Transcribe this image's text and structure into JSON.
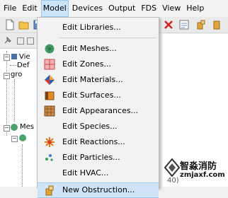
{
  "menubar": {
    "items": [
      "File",
      "Edit",
      "Model",
      "Devices",
      "Output",
      "FDS",
      "View",
      "Help"
    ]
  },
  "left_tree": {
    "labels": [
      "Vie",
      "Def",
      "gro",
      "Mes"
    ]
  },
  "right_panel": {
    "coords": "40)"
  },
  "model_menu": {
    "items": [
      {
        "label": "Edit Libraries...",
        "icon": "none"
      },
      {
        "label": "Edit Meshes...",
        "icon": "mesh-icon"
      },
      {
        "label": "Edit Zones...",
        "icon": "zone-icon"
      },
      {
        "label": "Edit Materials...",
        "icon": "material-icon"
      },
      {
        "label": "Edit Surfaces...",
        "icon": "surface-icon"
      },
      {
        "label": "Edit Appearances...",
        "icon": "appearance-icon"
      },
      {
        "label": "Edit Species...",
        "icon": "none"
      },
      {
        "label": "Edit Reactions...",
        "icon": "reaction-icon"
      },
      {
        "label": "Edit Particles...",
        "icon": "particle-icon"
      },
      {
        "label": "Edit HVAC...",
        "icon": "none"
      },
      {
        "label": "New Obstruction...",
        "icon": "obstruction-icon"
      }
    ]
  },
  "watermark": {
    "line1": "智淼消防",
    "line2": "zmjaxf.com"
  }
}
